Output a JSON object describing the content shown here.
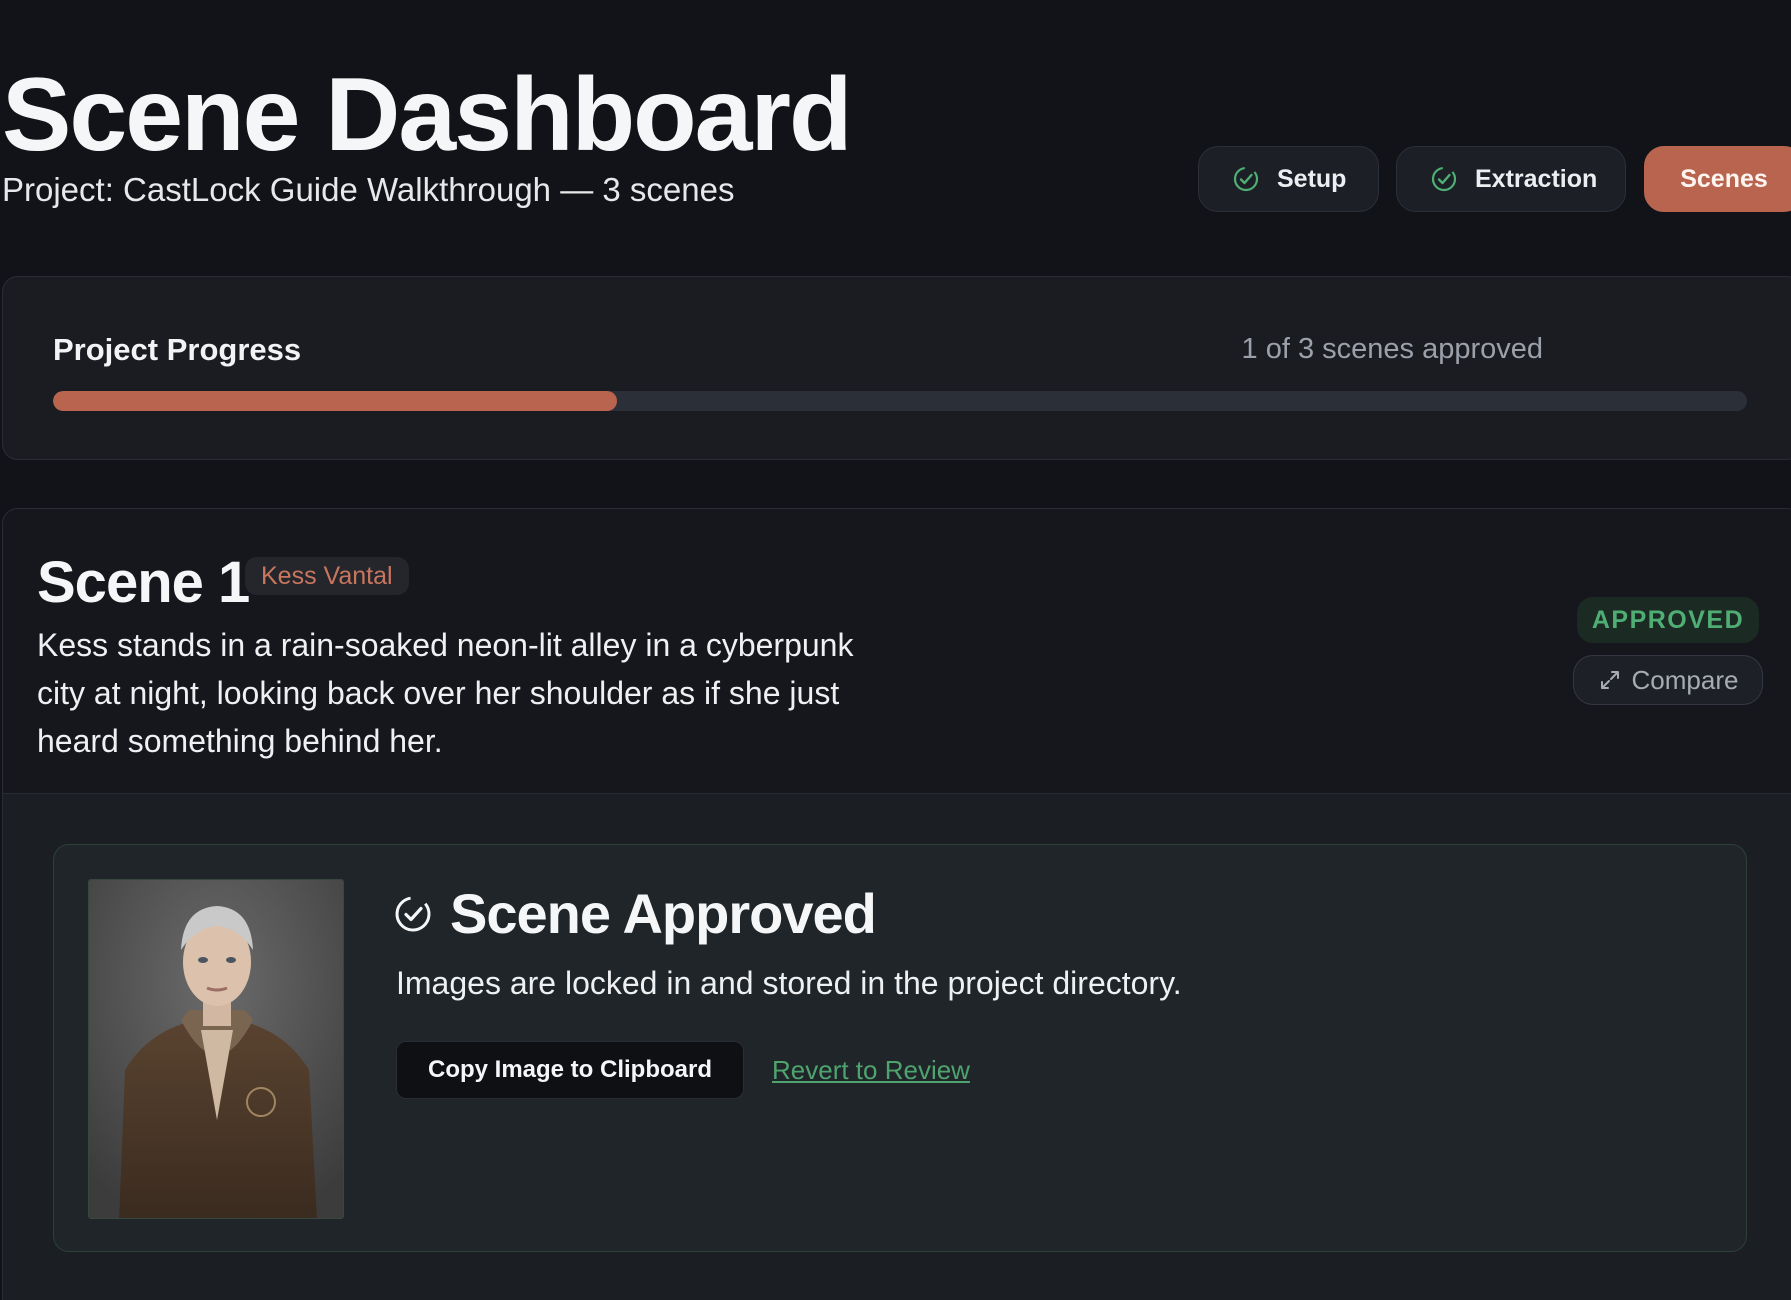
{
  "header": {
    "title": "Scene Dashboard",
    "subtitle": "Project: CastLock Guide Walkthrough — 3 scenes"
  },
  "steps": [
    {
      "label": "Setup",
      "icon": "check-circle-icon",
      "state": "complete"
    },
    {
      "label": "Extraction",
      "icon": "check-circle-icon",
      "state": "complete"
    },
    {
      "label": "Scenes",
      "state": "active"
    }
  ],
  "progress": {
    "title": "Project Progress",
    "count_text": "1 of 3 scenes approved",
    "approved": 1,
    "total": 3,
    "fraction": 0.333
  },
  "scene": {
    "title": "Scene 1",
    "character": "Kess Vantal",
    "description": "Kess stands in a rain-soaked neon-lit alley in a cyberpunk city at night, looking back over her shoulder as if she just heard something behind her.",
    "status": "APPROVED",
    "compare_label": "Compare",
    "approved_panel": {
      "title": "Scene Approved",
      "text": "Images are locked in and stored in the project directory.",
      "copy_label": "Copy Image to Clipboard",
      "revert_label": "Revert to Review"
    }
  },
  "colors": {
    "accent": "#b8644f",
    "success": "#4fae74",
    "background": "#121318"
  }
}
